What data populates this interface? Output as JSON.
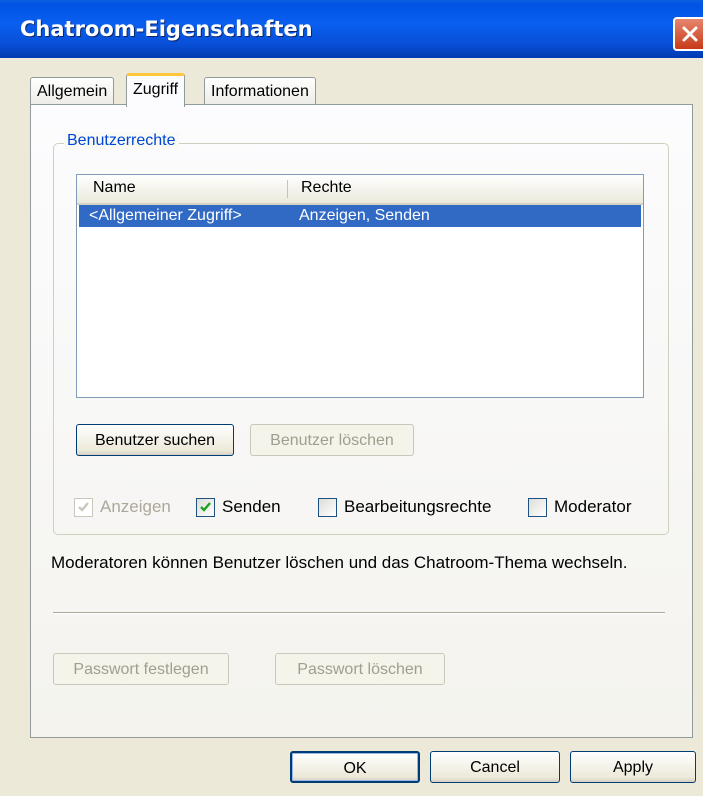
{
  "window": {
    "title": "Chatroom-Eigenschaften"
  },
  "tabs": [
    {
      "label": "Allgemein",
      "active": false
    },
    {
      "label": "Zugriff",
      "active": true
    },
    {
      "label": "Informationen",
      "active": false
    }
  ],
  "permissions": {
    "group_label": "Benutzerrechte",
    "columns": [
      "Name",
      "Rechte"
    ],
    "rows": [
      {
        "name": "<Allgemeiner Zugriff>",
        "rights": "Anzeigen, Senden",
        "selected": true
      }
    ],
    "find_user_label": "Benutzer suchen",
    "delete_user_label": "Benutzer löschen",
    "checkboxes": [
      {
        "label": "Anzeigen",
        "checked": true,
        "enabled": false
      },
      {
        "label": "Senden",
        "checked": true,
        "enabled": true
      },
      {
        "label": "Bearbeitungsrechte",
        "checked": false,
        "enabled": true
      },
      {
        "label": "Moderator",
        "checked": false,
        "enabled": true
      }
    ]
  },
  "info_text": "Moderatoren können Benutzer löschen und das Chatroom-Thema wechseln.",
  "password": {
    "set_label": "Passwort festlegen",
    "delete_label": "Passwort löschen"
  },
  "footer": {
    "ok_label": "OK",
    "cancel_label": "Cancel",
    "apply_label": "Apply"
  },
  "colors": {
    "titlebar": "#0053e3",
    "selection": "#316ac5",
    "group_label": "#0046d5",
    "active_tab_accent": "#ffc83c",
    "checkmark": "#21a121"
  }
}
